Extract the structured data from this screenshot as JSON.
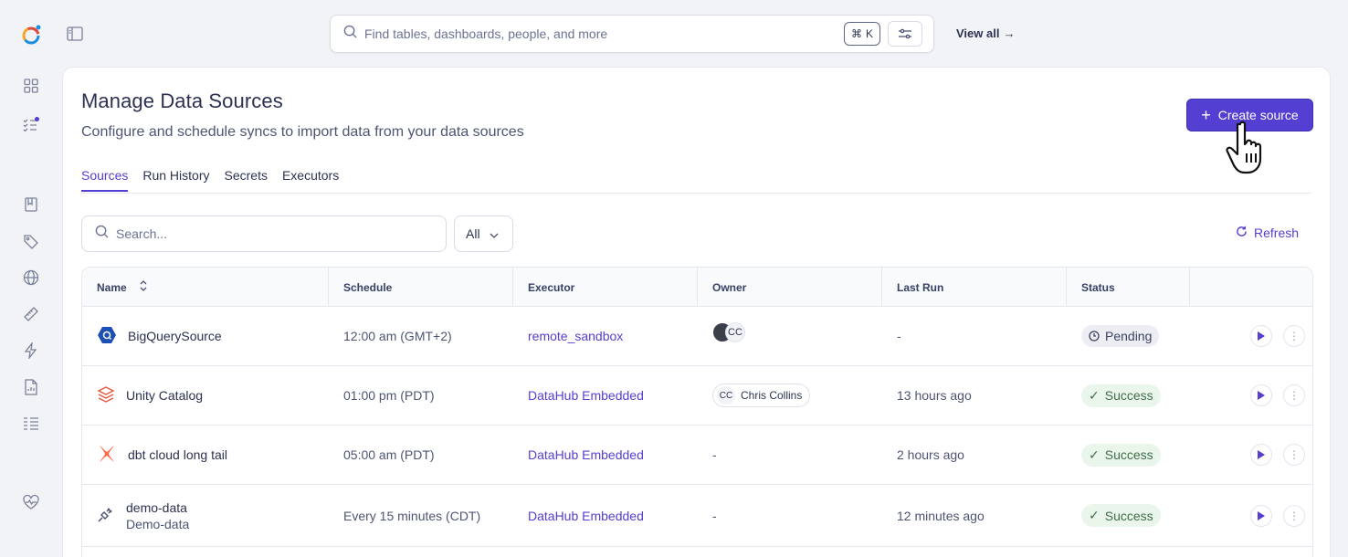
{
  "topbar": {
    "search_placeholder": "Find tables, dashboards, people, and more",
    "shortcut_symbol": "⌘",
    "shortcut_key": "K",
    "view_all_label": "View all"
  },
  "page": {
    "title": "Manage Data Sources",
    "subtitle": "Configure and schedule syncs to import data from your data sources",
    "create_button_label": "Create source",
    "tabs": [
      "Sources",
      "Run History",
      "Secrets",
      "Executors"
    ],
    "active_tab": "Sources"
  },
  "filters": {
    "search_placeholder": "Search...",
    "select_value": "All",
    "refresh_label": "Refresh"
  },
  "table": {
    "columns": [
      "Name",
      "Schedule",
      "Executor",
      "Owner",
      "Last Run",
      "Status"
    ],
    "rows": [
      {
        "icon": "bigquery-icon",
        "name": "BigQuerySource",
        "subname": "",
        "schedule": "12:00 am (GMT+2)",
        "executor": "remote_sandbox",
        "owner_initials": "CC",
        "owner_name": "",
        "last_run": "-",
        "status": "Pending"
      },
      {
        "icon": "unity-catalog-icon",
        "name": "Unity Catalog",
        "subname": "",
        "schedule": "01:00 pm (PDT)",
        "executor": "DataHub Embedded",
        "owner_initials": "CC",
        "owner_name": "Chris Collins",
        "last_run": "13 hours ago",
        "status": "Success"
      },
      {
        "icon": "dbt-icon",
        "name": "dbt cloud long tail",
        "subname": "",
        "schedule": "05:00 am (PDT)",
        "executor": "DataHub Embedded",
        "owner_initials": "",
        "owner_name": "-",
        "last_run": "2 hours ago",
        "status": "Success"
      },
      {
        "icon": "plug-icon",
        "name": "demo-data",
        "subname": "Demo-data",
        "schedule": "Every 15 minutes (CDT)",
        "executor": "DataHub Embedded",
        "owner_initials": "",
        "owner_name": "-",
        "last_run": "12 minutes ago",
        "status": "Success"
      }
    ]
  },
  "colors": {
    "accent": "#533fd1",
    "success_bg": "#eaf5ec",
    "pending_bg": "#eceef3"
  }
}
